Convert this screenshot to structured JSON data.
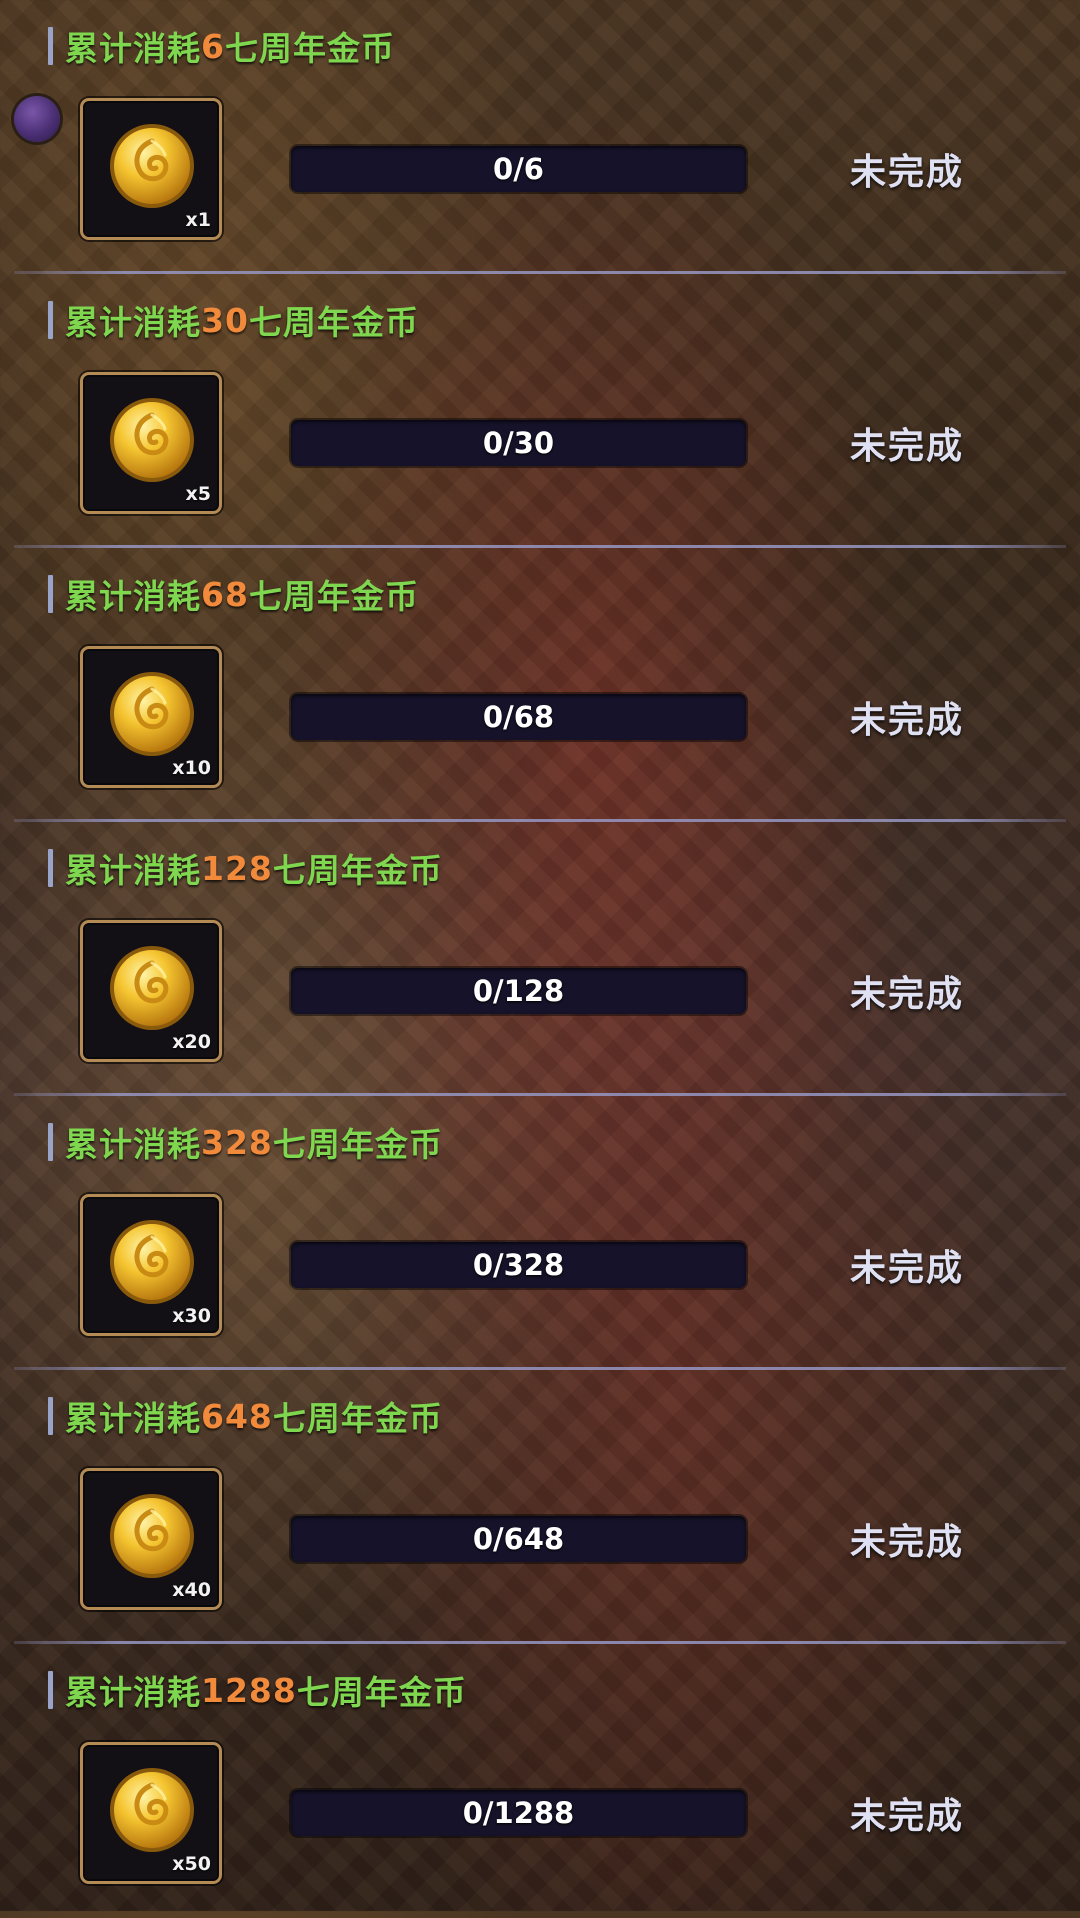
{
  "tasks": [
    {
      "title_prefix": "累计消耗",
      "amount": "6",
      "title_suffix": "七周年金币",
      "reward_count": "x1",
      "progress_text": "0/6",
      "progress": 0,
      "status": "未完成"
    },
    {
      "title_prefix": "累计消耗",
      "amount": "30",
      "title_suffix": "七周年金币",
      "reward_count": "x5",
      "progress_text": "0/30",
      "progress": 0,
      "status": "未完成"
    },
    {
      "title_prefix": "累计消耗",
      "amount": "68",
      "title_suffix": "七周年金币",
      "reward_count": "x10",
      "progress_text": "0/68",
      "progress": 0,
      "status": "未完成"
    },
    {
      "title_prefix": "累计消耗",
      "amount": "128",
      "title_suffix": "七周年金币",
      "reward_count": "x20",
      "progress_text": "0/128",
      "progress": 0,
      "status": "未完成"
    },
    {
      "title_prefix": "累计消耗",
      "amount": "328",
      "title_suffix": "七周年金币",
      "reward_count": "x30",
      "progress_text": "0/328",
      "progress": 0,
      "status": "未完成"
    },
    {
      "title_prefix": "累计消耗",
      "amount": "648",
      "title_suffix": "七周年金币",
      "reward_count": "x40",
      "progress_text": "0/648",
      "progress": 0,
      "status": "未完成"
    },
    {
      "title_prefix": "累计消耗",
      "amount": "1288",
      "title_suffix": "七周年金币",
      "reward_count": "x50",
      "progress_text": "0/1288",
      "progress": 0,
      "status": "未完成"
    }
  ],
  "icons": {
    "reward": "gold-coin-icon"
  },
  "colors": {
    "title": "#7fd64f",
    "amount_highlight": "#f28a3c",
    "status_text": "#dfe0f2",
    "progress_track": "#151229",
    "reward_frame": "#b48a55"
  }
}
